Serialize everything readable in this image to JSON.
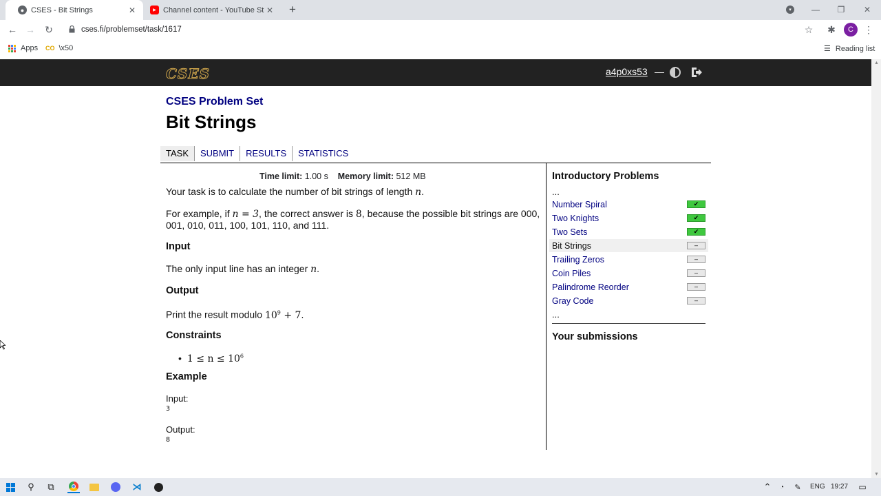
{
  "browser": {
    "tabs": [
      {
        "title": "CSES - Bit Strings",
        "favicon": "cses-favicon-icon",
        "active": true
      },
      {
        "title": "Channel content - YouTube Studio",
        "favicon": "youtube-icon",
        "active": false
      }
    ],
    "url": "cses.fi/problemset/task/1617",
    "bookmarks": [
      {
        "label": "Apps",
        "icon": "apps-grid-icon"
      },
      {
        "label": "\\x50",
        "icon": "bookmark-co-icon"
      }
    ],
    "reading_list": "Reading list",
    "profile_initial": "C"
  },
  "site": {
    "logo": "CSES",
    "username": "a4p0xs53",
    "dash": "—"
  },
  "problem": {
    "set_title": "CSES Problem Set",
    "title": "Bit Strings",
    "nav": [
      "TASK",
      "SUBMIT",
      "RESULTS",
      "STATISTICS"
    ],
    "time_limit_label": "Time limit:",
    "time_limit": "1.00 s",
    "memory_limit_label": "Memory limit:",
    "memory_limit": "512 MB",
    "statement_1a": "Your task is to calculate the number of bit strings of length",
    "statement_1_var": "n",
    "statement_2a": "For example, if",
    "statement_2_math": "n = 3",
    "statement_2b": ", the correct answer is",
    "statement_2_answer": "8",
    "statement_2c": ", because the possible bit strings are 000, 001, 010, 011, 100, 101, 110, and 111.",
    "input_heading": "Input",
    "input_text": "The only input line has an integer",
    "input_var": "n",
    "output_heading": "Output",
    "output_text": "Print the result modulo",
    "output_mod_base": "10",
    "output_mod_exp": "9",
    "output_mod_tail": "+ 7",
    "constraints_heading": "Constraints",
    "constraint_lhs": "1 ≤ n ≤ 10",
    "constraint_exp": "6",
    "example_heading": "Example",
    "example_input_label": "Input:",
    "example_input": "3",
    "example_output_label": "Output:",
    "example_output": "8"
  },
  "sidebar": {
    "title": "Introductory Problems",
    "dots_top": "...",
    "items": [
      {
        "label": "Number Spiral",
        "status": "solved",
        "mark": "✔"
      },
      {
        "label": "Two Knights",
        "status": "solved",
        "mark": "✔"
      },
      {
        "label": "Two Sets",
        "status": "solved",
        "mark": "✔"
      },
      {
        "label": "Bit Strings",
        "status": "unsolved",
        "mark": "–",
        "current": true
      },
      {
        "label": "Trailing Zeros",
        "status": "unsolved",
        "mark": "–"
      },
      {
        "label": "Coin Piles",
        "status": "unsolved",
        "mark": "–"
      },
      {
        "label": "Palindrome Reorder",
        "status": "unsolved",
        "mark": "–"
      },
      {
        "label": "Gray Code",
        "status": "unsolved",
        "mark": "–"
      }
    ],
    "dots_bottom": "...",
    "submissions_title": "Your submissions"
  },
  "taskbar": {
    "language": "ENG",
    "time": "19:27"
  },
  "colors": {
    "link": "#000080",
    "header_bg": "#222222",
    "solved": "#3fc83f"
  }
}
